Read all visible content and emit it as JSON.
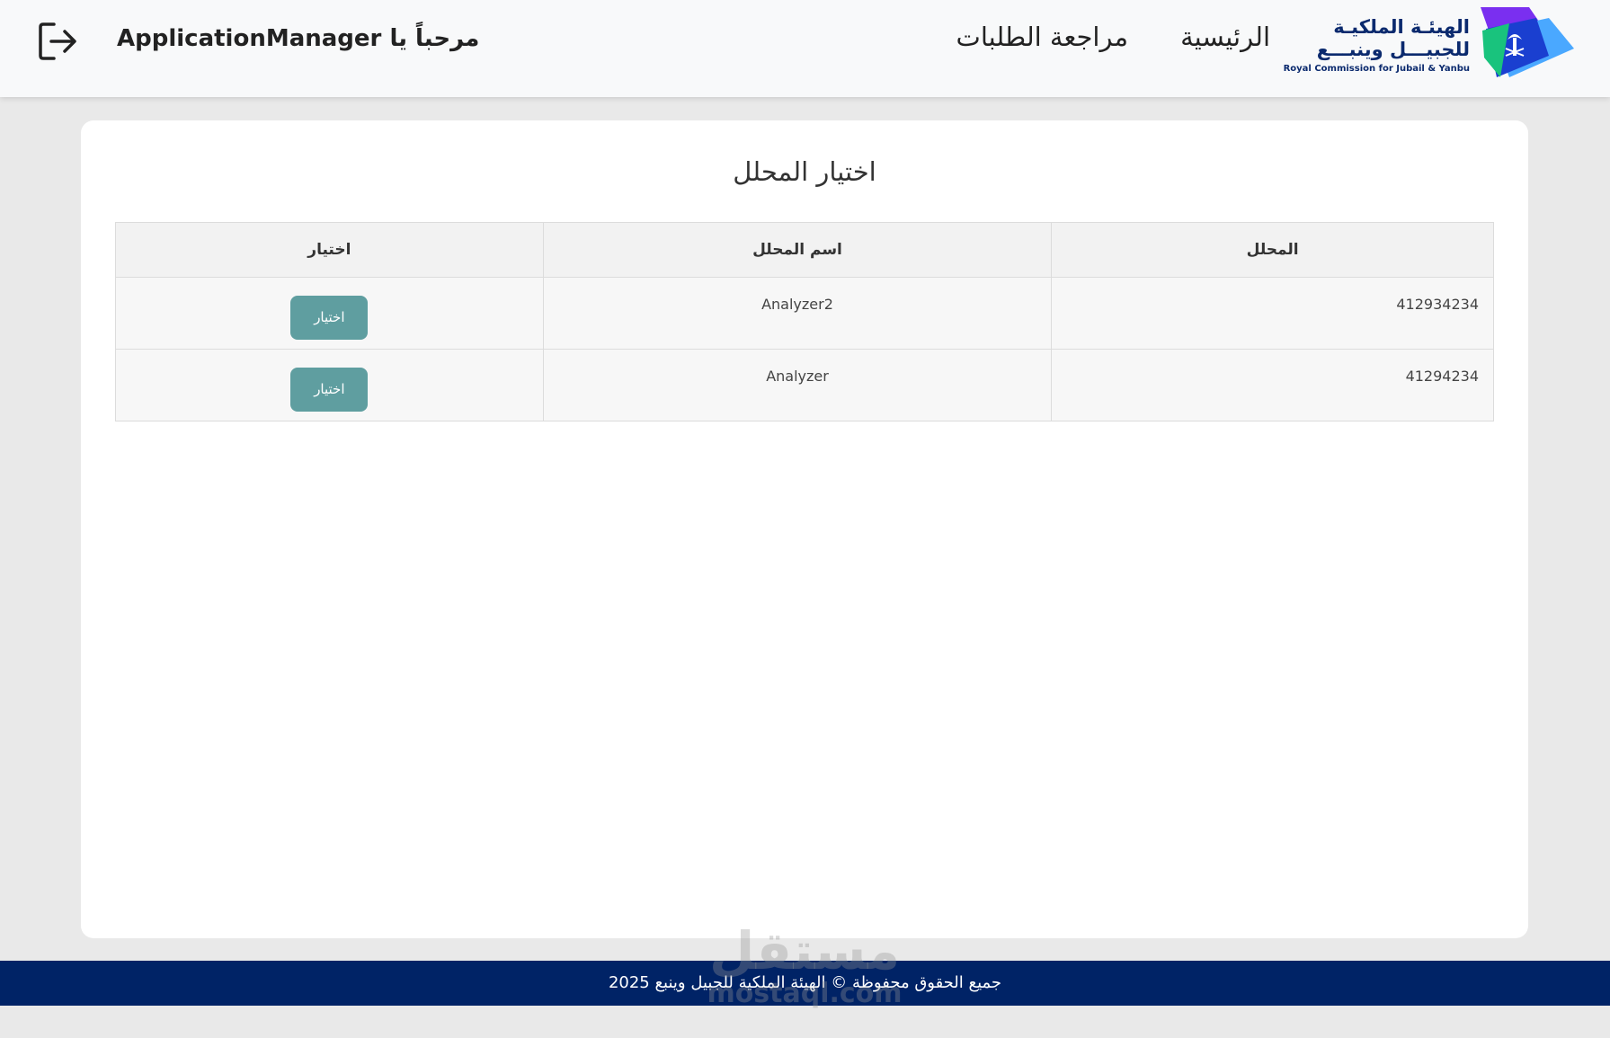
{
  "header": {
    "logo": {
      "name_ar_line1": "الهيئـة الملكيـة",
      "name_ar_line2": "للجبيـــل وينبـــع",
      "name_en": "Royal Commission for Jubail & Yanbu",
      "colors": [
        "#7a2ff0",
        "#1a3fd0",
        "#19c37d",
        "#4aa8ff"
      ]
    },
    "nav": {
      "home": "الرئيسية",
      "review": "مراجعة الطلبات"
    },
    "welcome": "مرحباً يا ApplicationManager",
    "logout_icon": "logout-icon"
  },
  "main": {
    "title": "اختيار المحلل",
    "table": {
      "columns": [
        "المحلل",
        "اسم المحلل",
        "اختيار"
      ],
      "rows": [
        {
          "id": "412934234",
          "name": "Analyzer2",
          "action": "اختيار"
        },
        {
          "id": "41294234",
          "name": "Analyzer",
          "action": "اختيار"
        }
      ]
    }
  },
  "footer": {
    "text": "جميع الحقوق محفوظة © الهيئة الملكية للجبيل وينبع 2025"
  },
  "watermark": {
    "ar": "مستقل",
    "en": "mostaql.com"
  },
  "colors": {
    "button": "#5f9ea0",
    "footer": "#002366",
    "brand_text": "#0b2a6e"
  }
}
